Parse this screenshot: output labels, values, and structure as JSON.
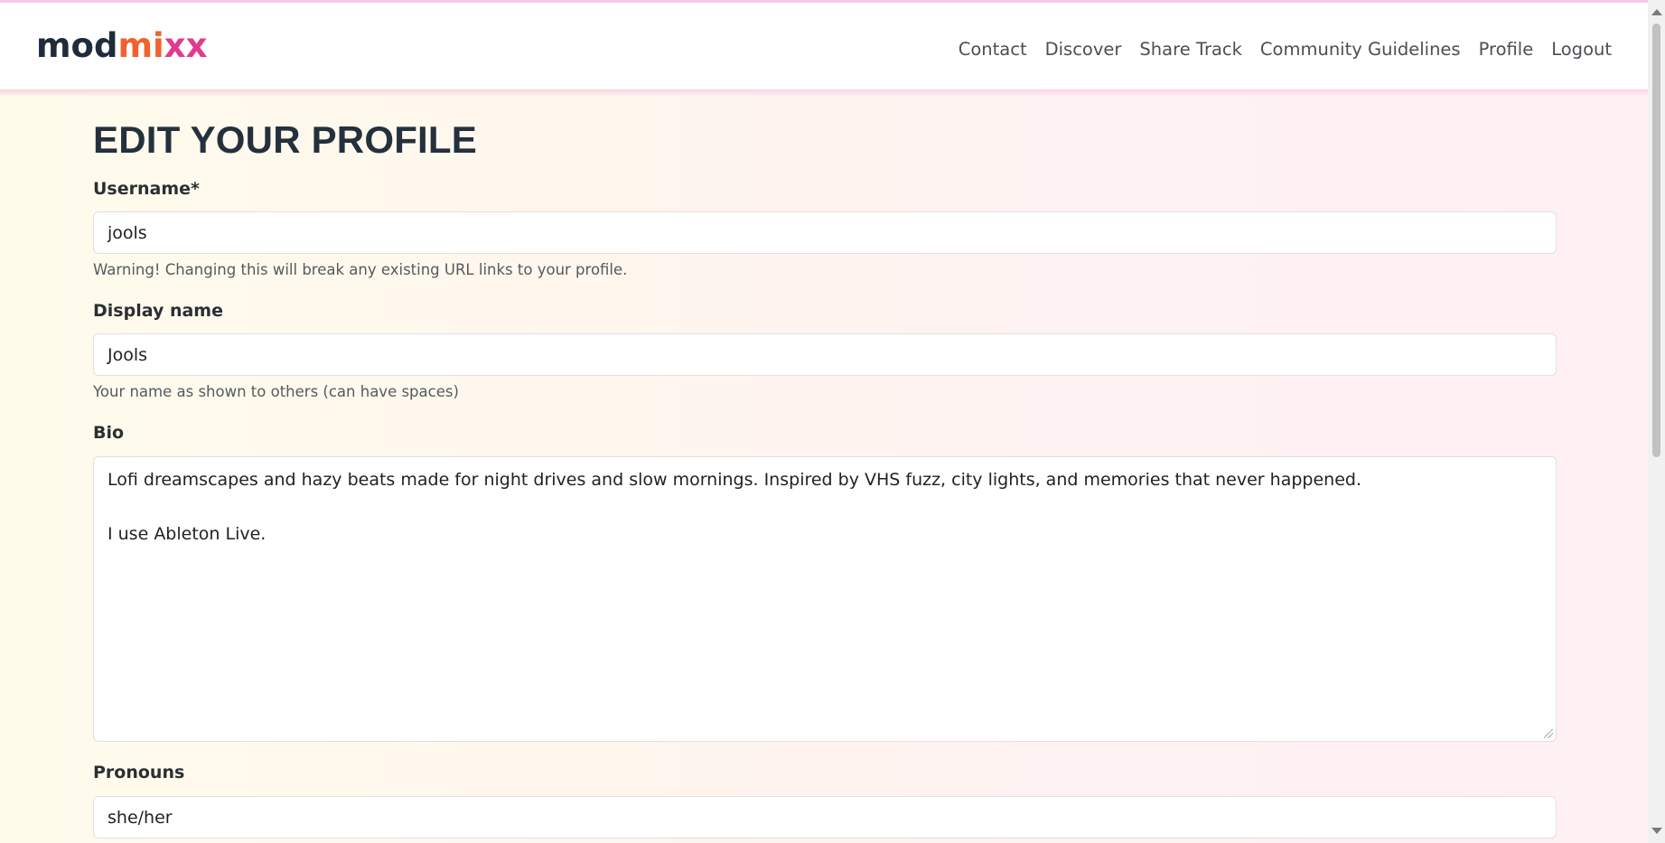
{
  "brand": {
    "part1": "mod",
    "part2": "mi",
    "part3": "xx"
  },
  "nav": {
    "items": [
      "Contact",
      "Discover",
      "Share Track",
      "Community Guidelines",
      "Profile",
      "Logout"
    ]
  },
  "page": {
    "title": "EDIT YOUR PROFILE"
  },
  "form": {
    "username": {
      "label": "Username*",
      "value": "jools",
      "help": "Warning! Changing this will break any existing URL links to your profile."
    },
    "display_name": {
      "label": "Display name",
      "value": "Jools",
      "help": "Your name as shown to others (can have spaces)"
    },
    "bio": {
      "label": "Bio",
      "line1": "Lofi dreamscapes and hazy beats made for night drives and slow mornings. Inspired by VHS fuzz, city lights, and memories that never happened.",
      "line2": "I use Ableton Live."
    },
    "pronouns": {
      "label": "Pronouns",
      "value": "she/her"
    }
  },
  "colors": {
    "brand_dark": "#1f2c3b",
    "brand_orange": "#f0622f",
    "brand_pink": "#e13a8e"
  }
}
